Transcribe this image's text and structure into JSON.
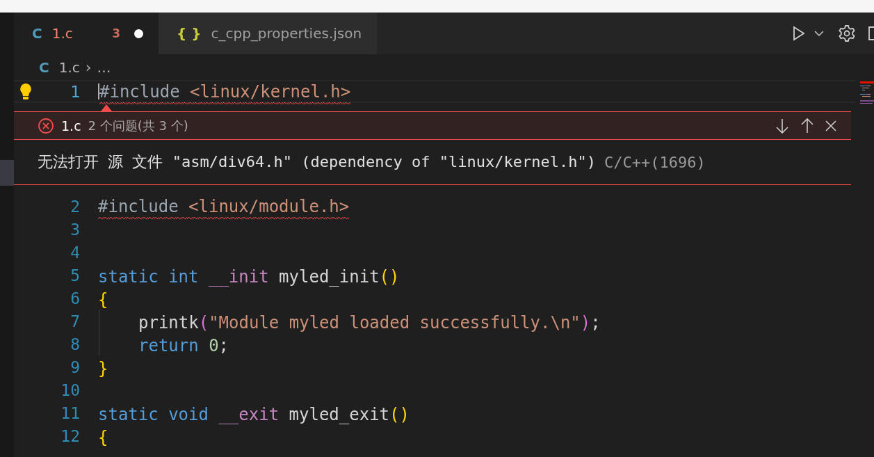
{
  "tabs": [
    {
      "icon": "C",
      "color": "#519aba",
      "label": "1.c",
      "problems": "3",
      "dirty": true,
      "error": true,
      "selected": true
    },
    {
      "icon": "{ }",
      "color": "#cbcb41",
      "label": "c_cpp_properties.json",
      "dirty": false,
      "error": false,
      "selected": false
    }
  ],
  "breadcrumb": {
    "icon": "C",
    "file": "1.c",
    "separator": "›",
    "rest": "…"
  },
  "lines": [
    {
      "number": "1",
      "current": true,
      "error": true,
      "indented": false,
      "tokens": [
        {
          "text": "#include",
          "kind": "directive"
        },
        {
          "text": " <linux/kernel.h>",
          "kind": "string"
        }
      ]
    },
    {
      "number": "2",
      "current": false,
      "error": true,
      "indented": false,
      "tokens": [
        {
          "text": "#include",
          "kind": "directive"
        },
        {
          "text": " <linux/module.h>",
          "kind": "string"
        }
      ]
    },
    {
      "number": "3",
      "current": false
    },
    {
      "number": "4",
      "current": false
    },
    {
      "number": "5",
      "current": false,
      "error": false,
      "indented": false,
      "tokens": [
        {
          "text": "static",
          "kind": "keyword"
        },
        {
          "text": " int",
          "kind": "keyword"
        },
        {
          "text": " __init",
          "kind": "macro"
        },
        {
          "text": " myled_init",
          "kind": "plain"
        },
        {
          "text": "()",
          "kind": "brace"
        }
      ]
    },
    {
      "number": "6",
      "current": false,
      "error": false,
      "indented": false,
      "tokens": [
        {
          "text": "{",
          "kind": "brace"
        }
      ]
    },
    {
      "number": "7",
      "current": false,
      "error": false,
      "indented": true,
      "tokens": [
        {
          "text": "printk",
          "kind": "plain"
        },
        {
          "text": "(",
          "kind": "paren"
        },
        {
          "text": "\"Module myled loaded successfully.\\n\"",
          "kind": "string"
        },
        {
          "text": ")",
          "kind": "paren"
        },
        {
          "text": ";",
          "kind": "plain"
        }
      ]
    },
    {
      "number": "8",
      "current": false,
      "error": false,
      "indented": true,
      "tokens": [
        {
          "text": "return",
          "kind": "keyword"
        },
        {
          "text": " 0",
          "kind": "number"
        },
        {
          "text": ";",
          "kind": "plain"
        }
      ]
    },
    {
      "number": "9",
      "current": false,
      "error": false,
      "indented": false,
      "tokens": [
        {
          "text": "}",
          "kind": "brace"
        }
      ]
    },
    {
      "number": "10",
      "current": false
    },
    {
      "number": "11",
      "current": false,
      "error": false,
      "indented": false,
      "tokens": [
        {
          "text": "static",
          "kind": "keyword"
        },
        {
          "text": " void",
          "kind": "keyword"
        },
        {
          "text": " __exit",
          "kind": "macro"
        },
        {
          "text": " myled_exit",
          "kind": "plain"
        },
        {
          "text": "()",
          "kind": "brace"
        }
      ]
    },
    {
      "number": "12",
      "current": false,
      "error": false,
      "indented": false,
      "tokens": [
        {
          "text": "{",
          "kind": "brace"
        }
      ]
    }
  ],
  "peek": {
    "file": "1.c",
    "summary": "2 个问题(共 3 个)",
    "message": "无法打开 源 文件 \"asm/div64.h\" (dependency of \"linux/kernel.h\")",
    "source": "C/C++(1696)"
  }
}
